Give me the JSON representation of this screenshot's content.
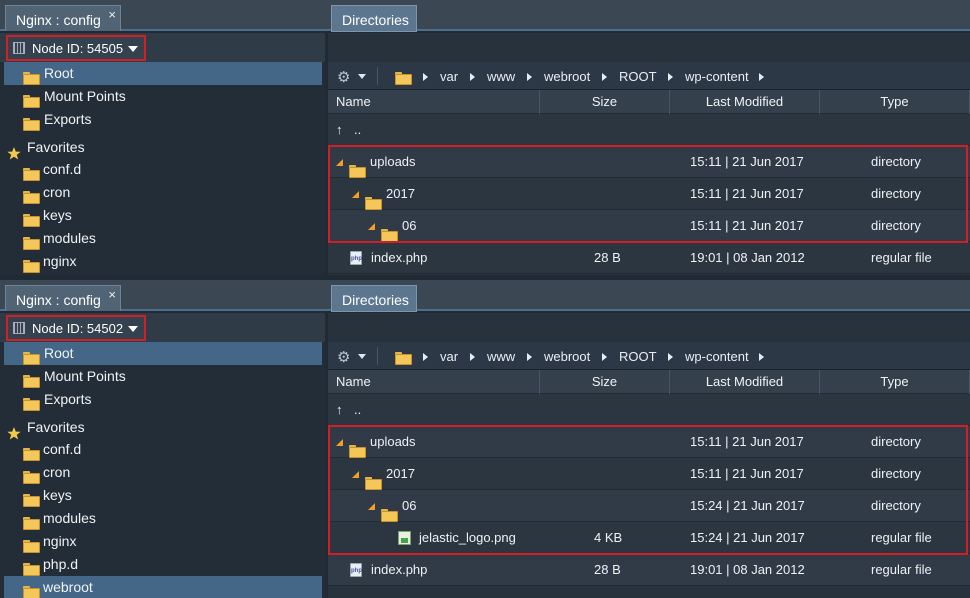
{
  "colors": {
    "accent_red": "#d21f26",
    "selected_row": "#446788",
    "folder": "#f3c75a"
  },
  "panels": [
    {
      "tab_title": "Nginx : config",
      "close": "×",
      "node_label": "Node ID: 54505",
      "tree": [
        "Root",
        "Mount Points",
        "Exports"
      ],
      "favorites_title": "Favorites",
      "favorites": [
        "conf.d",
        "cron",
        "keys",
        "modules",
        "nginx"
      ],
      "dir_tab": "Directories",
      "breadcrumb": [
        "var",
        "www",
        "webroot",
        "ROOT",
        "wp-content"
      ],
      "columns": {
        "name": "Name",
        "size": "Size",
        "modified": "Last Modified",
        "type": "Type"
      },
      "up_symbol": "↑",
      "up_label": "..",
      "rows": [
        {
          "name": "uploads",
          "size": "",
          "modified": "15:11 | 21 Jun 2017",
          "type": "directory",
          "level": 0,
          "kind": "dir"
        },
        {
          "name": "2017",
          "size": "",
          "modified": "15:11 | 21 Jun 2017",
          "type": "directory",
          "level": 1,
          "kind": "dir"
        },
        {
          "name": "06",
          "size": "",
          "modified": "15:11 | 21 Jun 2017",
          "type": "directory",
          "level": 2,
          "kind": "dir"
        },
        {
          "name": "index.php",
          "size": "28 B",
          "modified": "19:01 | 08 Jan 2012",
          "type": "regular file",
          "level": 0,
          "kind": "php"
        }
      ]
    },
    {
      "tab_title": "Nginx : config",
      "close": "×",
      "node_label": "Node ID: 54502",
      "tree": [
        "Root",
        "Mount Points",
        "Exports"
      ],
      "favorites_title": "Favorites",
      "favorites": [
        "conf.d",
        "cron",
        "keys",
        "modules",
        "nginx",
        "php.d",
        "webroot"
      ],
      "dir_tab": "Directories",
      "breadcrumb": [
        "var",
        "www",
        "webroot",
        "ROOT",
        "wp-content"
      ],
      "columns": {
        "name": "Name",
        "size": "Size",
        "modified": "Last Modified",
        "type": "Type"
      },
      "up_symbol": "↑",
      "up_label": "..",
      "rows": [
        {
          "name": "uploads",
          "size": "",
          "modified": "15:11 | 21 Jun 2017",
          "type": "directory",
          "level": 0,
          "kind": "dir"
        },
        {
          "name": "2017",
          "size": "",
          "modified": "15:11 | 21 Jun 2017",
          "type": "directory",
          "level": 1,
          "kind": "dir"
        },
        {
          "name": "06",
          "size": "",
          "modified": "15:24 | 21 Jun 2017",
          "type": "directory",
          "level": 2,
          "kind": "dir"
        },
        {
          "name": "jelastic_logo.png",
          "size": "4 KB",
          "modified": "15:24 | 21 Jun 2017",
          "type": "regular file",
          "level": 3,
          "kind": "png"
        },
        {
          "name": "index.php",
          "size": "28 B",
          "modified": "19:01 | 08 Jan 2012",
          "type": "regular file",
          "level": 0,
          "kind": "php"
        }
      ]
    }
  ]
}
